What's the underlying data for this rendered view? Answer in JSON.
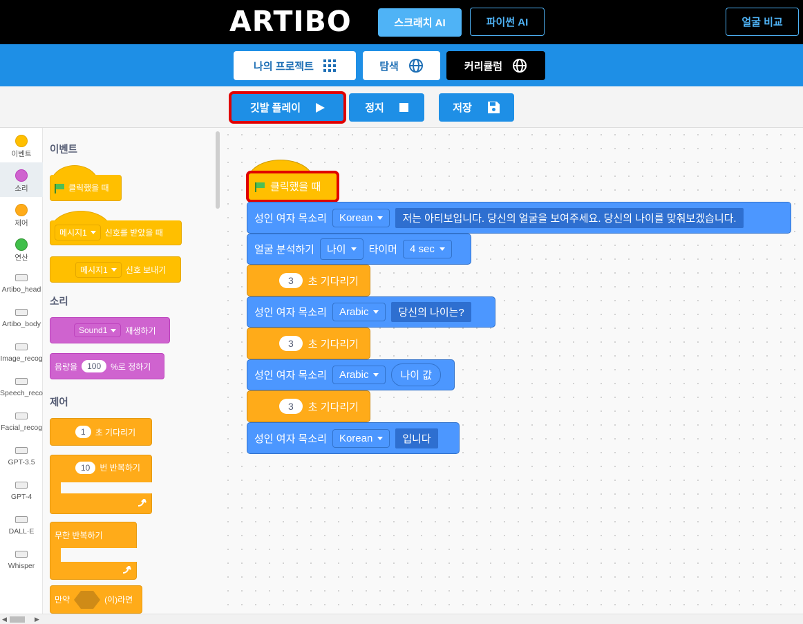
{
  "topbar": {
    "logo": "ARTIBO",
    "scratch_ai": "스크래치 AI",
    "python_ai": "파이썬 AI",
    "face_compare": "얼굴 비교"
  },
  "nav": {
    "my_projects": "나의 프로젝트",
    "explore": "탐색",
    "curriculum": "커리큘럼"
  },
  "toolbar": {
    "flag_play": "깃발 플레이",
    "stop": "정지",
    "save": "저장"
  },
  "categories": [
    {
      "label": "이벤트",
      "color": "#ffbf00"
    },
    {
      "label": "소리",
      "color": "#cf63cf"
    },
    {
      "label": "제어",
      "color": "#ffab19"
    },
    {
      "label": "연산",
      "color": "#40bf4a"
    },
    {
      "label": "Artibo_head"
    },
    {
      "label": "Artibo_body"
    },
    {
      "label": "Image_recog"
    },
    {
      "label": "Speech_reco"
    },
    {
      "label": "Facial_recog"
    },
    {
      "label": "GPT-3.5"
    },
    {
      "label": "GPT-4"
    },
    {
      "label": "DALL·E"
    },
    {
      "label": "Whisper"
    }
  ],
  "palette": {
    "events_title": "이벤트",
    "when_flag": "클릭했을 때",
    "message_dd": "메시지1",
    "when_receive": "신호를 받았을 때",
    "broadcast": "신호 보내기",
    "sound_title": "소리",
    "sound_dd": "Sound1",
    "play_sound": "재생하기",
    "volume_pre": "음량을",
    "volume_val": "100",
    "volume_post": "%로 정하기",
    "control_title": "제어",
    "wait_val": "1",
    "wait_label": "초 기다리기",
    "repeat_val": "10",
    "repeat_label": "번 반복하기",
    "forever": "무한 반복하기",
    "if_pre": "만약",
    "if_post": "(이)라면"
  },
  "script": {
    "hat": "클릭했을 때",
    "speak_label": "성인 여자 목소리",
    "lang_korean": "Korean",
    "lang_arabic": "Arabic",
    "speak1_text": "저는 아티보입니다. 당신의 얼굴을 보여주세요. 당신의 나이를 맞춰보겠습니다.",
    "analyze_label": "얼굴 분석하기",
    "analyze_dd": "나이",
    "timer_label": "타이머",
    "timer_dd": "4 sec",
    "wait_val": "3",
    "wait_label": "초 기다리기",
    "speak2_text": "당신의 나이는?",
    "age_value": "나이 값",
    "speak4_text": "입니다"
  }
}
